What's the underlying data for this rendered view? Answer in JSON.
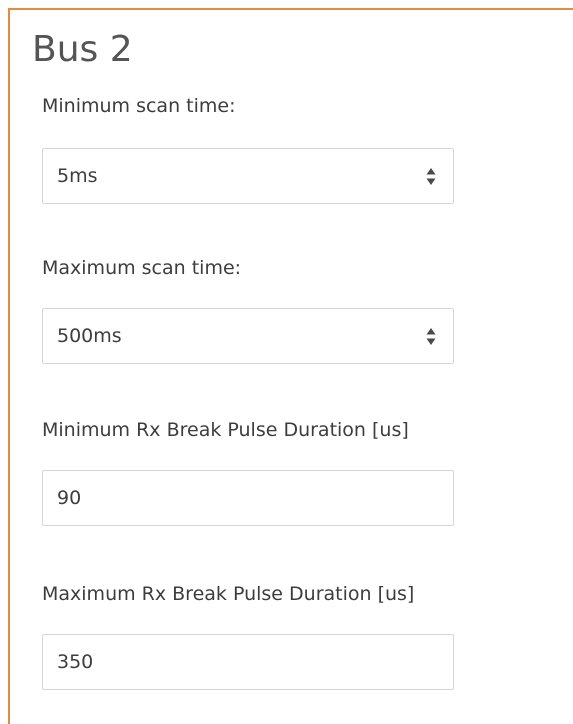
{
  "bus": {
    "title": "Bus 2"
  },
  "min_scan": {
    "label": "Minimum scan time:",
    "value": "5ms"
  },
  "max_scan": {
    "label": "Maximum scan time:",
    "value": "500ms"
  },
  "min_rx": {
    "label": "Minimum Rx Break Pulse Duration [us]",
    "value": "90"
  },
  "max_rx": {
    "label": "Maximum Rx Break Pulse Duration [us]",
    "value": "350"
  },
  "colors": {
    "panel_border": "#e38b43",
    "field_border": "#d6d6d6"
  },
  "icons": {
    "select_indicator": "up-down-arrows-icon"
  }
}
